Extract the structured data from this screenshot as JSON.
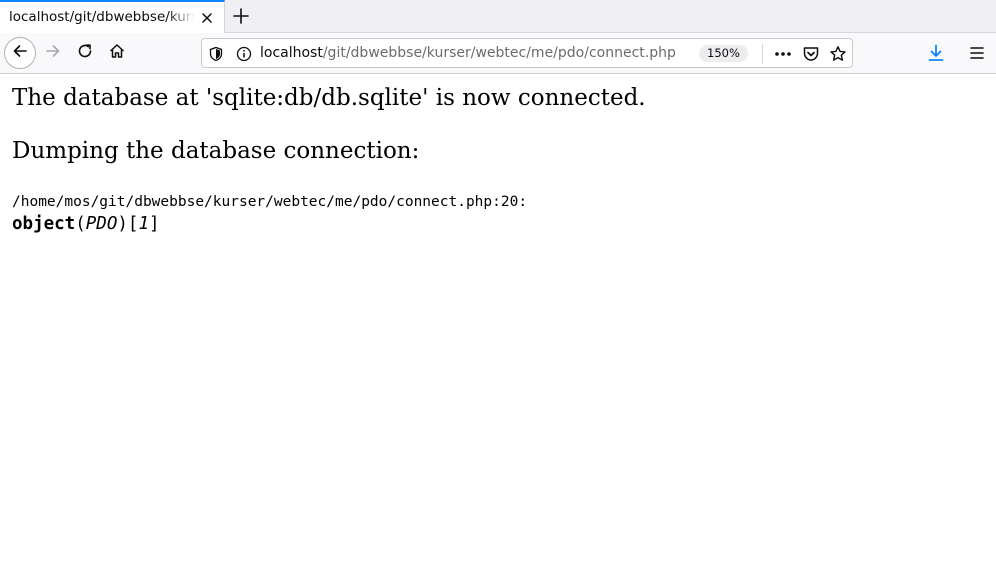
{
  "tab": {
    "title": "localhost/git/dbwebbse/kurser/webtec/me/pdo/connect.php"
  },
  "address": {
    "host": "localhost",
    "path": "/git/dbwebbse/kurser/webtec/me/pdo/connect.php",
    "zoom": "150%"
  },
  "page": {
    "connected_message": "The database at 'sqlite:db/db.sqlite' is now connected.",
    "dump_heading": "Dumping the database connection:",
    "dump_path": "/home/mos/git/dbwebbse/kurser/webtec/me/pdo/connect.php:20:",
    "dump_keyword": "object",
    "dump_class": "PDO",
    "dump_index": "1"
  },
  "icons": [
    "close-icon",
    "plus-icon",
    "back-arrow-icon",
    "forward-arrow-icon",
    "reload-icon",
    "home-icon",
    "shield-icon",
    "info-icon",
    "more-icon",
    "pocket-icon",
    "star-icon",
    "download-icon",
    "hamburger-menu-icon"
  ],
  "colors": {
    "accent": "#0a84ff",
    "tab_bg": "#f0f0f4"
  }
}
